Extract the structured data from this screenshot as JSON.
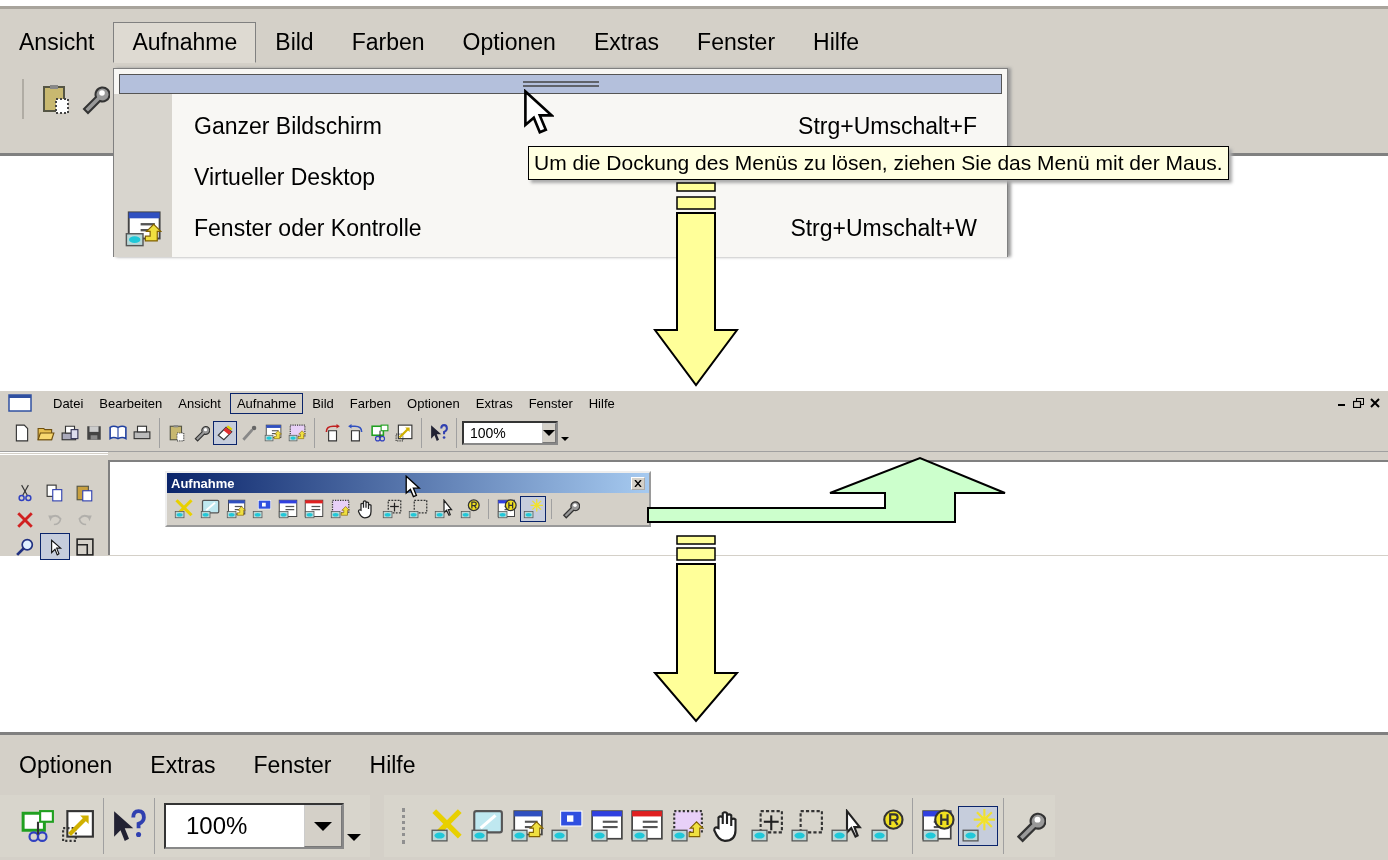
{
  "panel_undocking": {
    "menubar": [
      {
        "label": "Ansicht",
        "selected": false
      },
      {
        "label": "Aufnahme",
        "selected": true
      },
      {
        "label": "Bild",
        "selected": false
      },
      {
        "label": "Farben",
        "selected": false
      },
      {
        "label": "Optionen",
        "selected": false
      },
      {
        "label": "Extras",
        "selected": false
      },
      {
        "label": "Fenster",
        "selected": false
      },
      {
        "label": "Hilfe",
        "selected": false
      }
    ],
    "toolbar": [
      {
        "kind": "clipboard",
        "pressed": false
      },
      {
        "kind": "wrench",
        "pressed": false
      }
    ],
    "menu": {
      "items": [
        {
          "kind": "plain",
          "label": "Ganzer Bildschirm",
          "shortcut": "Strg+Umschalt+F"
        },
        {
          "kind": "plain",
          "label": "Virtueller Desktop"
        },
        {
          "kind": "window-arrow",
          "label": "Fenster oder Kontrolle",
          "shortcut": "Strg+Umschalt+W"
        }
      ]
    },
    "tooltip": "Um die Dockung des Menüs zu lösen, ziehen Sie das Menü mit der Maus."
  },
  "panel_floating": {
    "menubar": [
      {
        "label": "Datei",
        "selected": false
      },
      {
        "label": "Bearbeiten",
        "selected": false
      },
      {
        "label": "Ansicht",
        "selected": false
      },
      {
        "label": "Aufnahme",
        "selected": true
      },
      {
        "label": "Bild",
        "selected": false
      },
      {
        "label": "Farben",
        "selected": false
      },
      {
        "label": "Optionen",
        "selected": false
      },
      {
        "label": "Extras",
        "selected": false
      },
      {
        "label": "Fenster",
        "selected": false
      },
      {
        "label": "Hilfe",
        "selected": false
      }
    ],
    "toolbar": [
      {
        "kind": "page",
        "pressed": false
      },
      {
        "kind": "folder",
        "pressed": false
      },
      {
        "kind": "scanner",
        "pressed": false
      },
      {
        "kind": "floppy",
        "pressed": false
      },
      {
        "kind": "book",
        "pressed": false
      },
      {
        "kind": "printer",
        "pressed": false
      },
      {
        "kind": "separator"
      },
      {
        "kind": "clipboard",
        "pressed": false
      },
      {
        "kind": "wrench",
        "pressed": false
      },
      {
        "kind": "eraser",
        "pressed": true
      },
      {
        "kind": "pipette",
        "pressed": false
      },
      {
        "kind": "window-arrow",
        "pressed": false
      },
      {
        "kind": "dotted-window-arrow",
        "pressed": false
      },
      {
        "kind": "separator"
      },
      {
        "kind": "page-arrow-right",
        "pressed": false
      },
      {
        "kind": "page-arrow-left",
        "pressed": false
      },
      {
        "kind": "crop",
        "pressed": false
      },
      {
        "kind": "resize",
        "pressed": false
      },
      {
        "kind": "separator"
      },
      {
        "kind": "help-pointer",
        "pressed": false
      },
      {
        "kind": "separator"
      }
    ],
    "zoom_box": {
      "value": "100%"
    },
    "side_toolbar": [
      {
        "kind": "scissors",
        "pressed": false,
        "disabled": false
      },
      {
        "kind": "copy",
        "pressed": false,
        "disabled": false
      },
      {
        "kind": "paste",
        "pressed": false,
        "disabled": false
      },
      {
        "kind": "delete",
        "pressed": false,
        "disabled": false
      },
      {
        "kind": "undo",
        "pressed": false,
        "disabled": true
      },
      {
        "kind": "redo",
        "pressed": false,
        "disabled": true
      },
      {
        "kind": "magnifier",
        "pressed": false,
        "disabled": false
      },
      {
        "kind": "pointer",
        "pressed": true,
        "disabled": false
      },
      {
        "kind": "frame",
        "pressed": false,
        "disabled": false
      }
    ],
    "floating_toolbar": {
      "title": "Aufnahme",
      "buttons": [
        {
          "kind": "cross-capture",
          "pressed": false
        },
        {
          "kind": "display",
          "pressed": false
        },
        {
          "kind": "window-arrow",
          "pressed": false
        },
        {
          "kind": "window-b",
          "pressed": false
        },
        {
          "kind": "window-list",
          "pressed": false
        },
        {
          "kind": "window-form",
          "pressed": false
        },
        {
          "kind": "dotted-window-arrow",
          "pressed": false
        },
        {
          "kind": "hand",
          "pressed": false
        },
        {
          "kind": "move-frame",
          "pressed": false
        },
        {
          "kind": "dotted-frame",
          "pressed": false
        },
        {
          "kind": "pointer-capture",
          "pressed": false
        },
        {
          "kind": "badge-r",
          "pressed": false
        },
        {
          "kind": "separator"
        },
        {
          "kind": "badge-h",
          "pressed": false
        },
        {
          "kind": "sparkle",
          "pressed": true
        },
        {
          "kind": "separator"
        },
        {
          "kind": "wrench",
          "pressed": false
        }
      ]
    }
  },
  "panel_docked": {
    "menubar": [
      {
        "label": "Optionen",
        "selected": false
      },
      {
        "label": "Extras",
        "selected": false
      },
      {
        "label": "Fenster",
        "selected": false
      },
      {
        "label": "Hilfe",
        "selected": false
      }
    ],
    "toolbar": [
      {
        "kind": "crop",
        "pressed": false
      },
      {
        "kind": "resize",
        "pressed": false
      },
      {
        "kind": "separator"
      },
      {
        "kind": "help-pointer",
        "pressed": false
      },
      {
        "kind": "separator"
      }
    ],
    "zoom_box": {
      "value": "100%"
    },
    "capture_toolbar": [
      {
        "kind": "cross-capture",
        "pressed": false
      },
      {
        "kind": "display",
        "pressed": false
      },
      {
        "kind": "window-arrow",
        "pressed": false
      },
      {
        "kind": "window-b",
        "pressed": false
      },
      {
        "kind": "window-list",
        "pressed": false
      },
      {
        "kind": "window-form",
        "pressed": false
      },
      {
        "kind": "dotted-window-arrow",
        "pressed": false
      },
      {
        "kind": "hand",
        "pressed": false
      },
      {
        "kind": "move-frame",
        "pressed": false
      },
      {
        "kind": "dotted-frame",
        "pressed": false
      },
      {
        "kind": "pointer-capture",
        "pressed": false
      },
      {
        "kind": "badge-r",
        "pressed": false
      },
      {
        "kind": "separator"
      },
      {
        "kind": "badge-h",
        "pressed": false
      },
      {
        "kind": "sparkle",
        "pressed": true
      },
      {
        "kind": "separator"
      },
      {
        "kind": "wrench",
        "pressed": false
      }
    ]
  }
}
